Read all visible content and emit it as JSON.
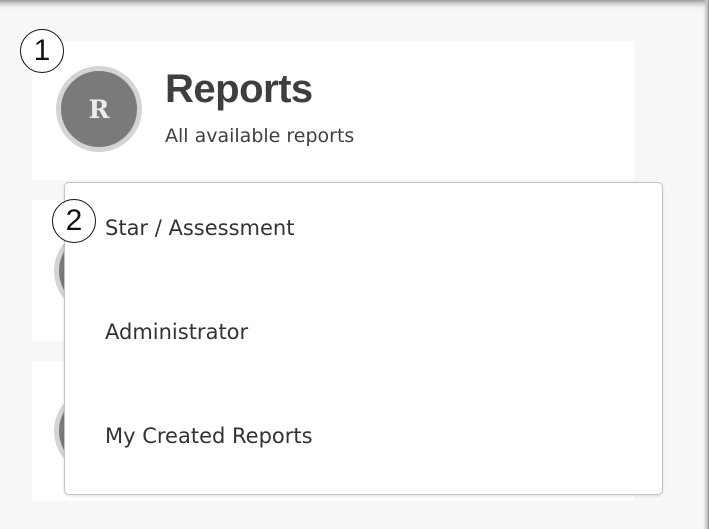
{
  "reports_card": {
    "avatar_letter": "R",
    "title": "Reports",
    "subtitle": "All available reports"
  },
  "dropdown": {
    "items": [
      {
        "label": "Star / Assessment"
      },
      {
        "label": "Administrator"
      },
      {
        "label": "My Created Reports"
      }
    ]
  },
  "callouts": [
    "1",
    "2"
  ],
  "colors": {
    "avatar_bg": "#7a7a7a",
    "avatar_ring": "#d4d4d4",
    "page_bg": "#f7f7f7",
    "card_bg": "#ffffff"
  }
}
